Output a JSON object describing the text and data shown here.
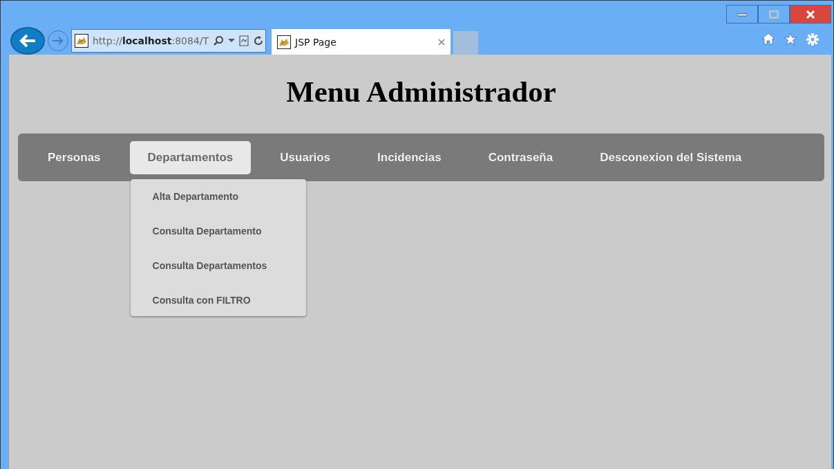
{
  "browser": {
    "address": "http://**localhost**:8084/T",
    "tabs": [
      {
        "title": "JSP Page",
        "selected": true
      }
    ]
  },
  "page": {
    "heading": "Menu Administrador"
  },
  "nav": {
    "items": [
      {
        "label": "Personas",
        "selected": false
      },
      {
        "label": "Departamentos",
        "selected": true,
        "expanded": true,
        "submenu": [
          "Alta Departamento",
          "Consulta Departamento",
          "Consulta Departamentos",
          "Consulta con FILTRO"
        ]
      },
      {
        "label": "Usuarios",
        "selected": false
      },
      {
        "label": "Incidencias",
        "selected": false
      },
      {
        "label": "Contraseña",
        "selected": false
      },
      {
        "label": "Desconexion del Sistema",
        "selected": false
      }
    ]
  }
}
